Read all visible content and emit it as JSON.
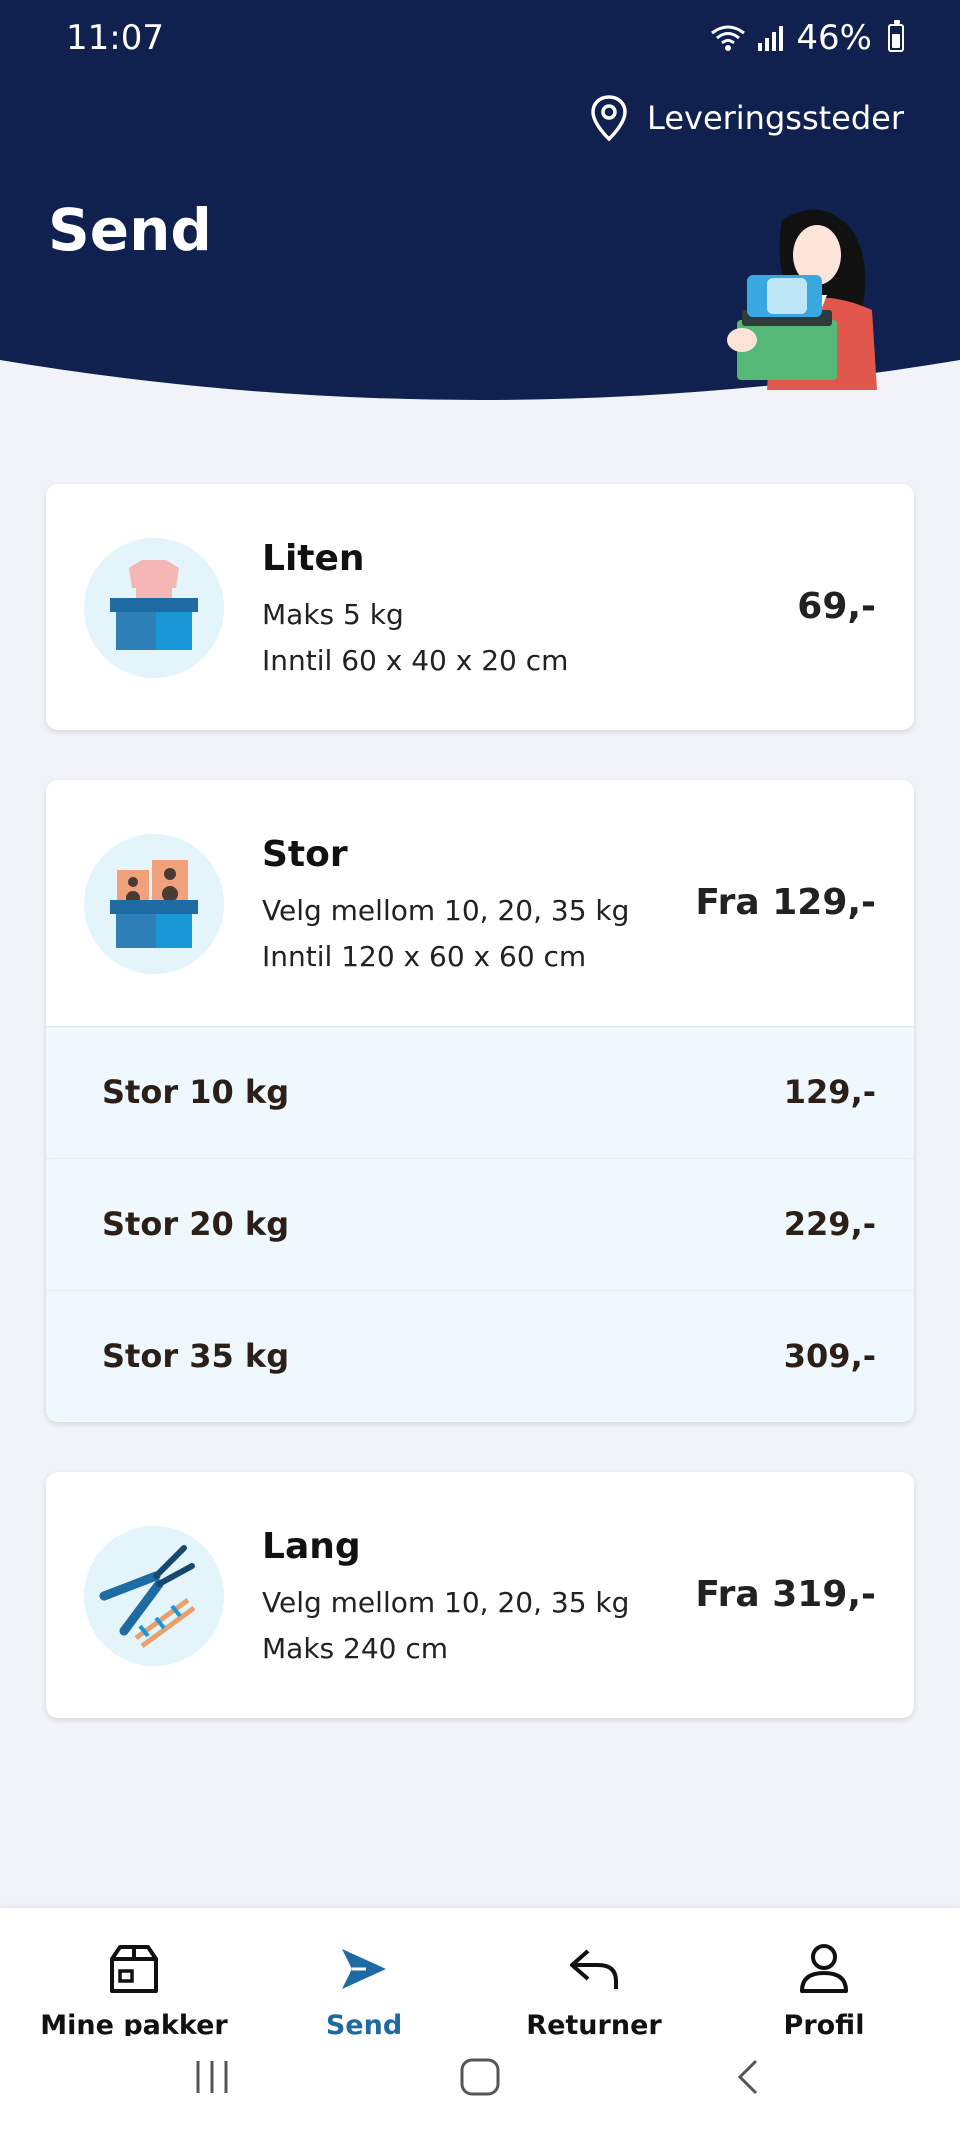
{
  "status_bar": {
    "time": "11:07",
    "battery": "46%"
  },
  "header": {
    "delivery_link": "Leveringssteder",
    "title": "Send"
  },
  "products": [
    {
      "title": "Liten",
      "line1": "Maks 5 kg",
      "line2": "Inntil 60 x 40 x 20 cm",
      "price": "69,-",
      "icon": "box-with-shirt-icon"
    },
    {
      "title": "Stor",
      "line1": "Velg mellom 10, 20, 35 kg",
      "line2": "Inntil 120 x 60 x 60 cm",
      "price": "Fra 129,-",
      "icon": "box-with-speakers-icon",
      "options": [
        {
          "label": "Stor 10 kg",
          "price": "129,-"
        },
        {
          "label": "Stor 20 kg",
          "price": "229,-"
        },
        {
          "label": "Stor 35 kg",
          "price": "309,-"
        }
      ]
    },
    {
      "title": "Lang",
      "line1": "Velg mellom 10, 20, 35 kg",
      "line2": "Maks 240 cm",
      "price": "Fra 319,-",
      "icon": "garden-shears-and-ski-icon"
    }
  ],
  "bottom_nav": [
    {
      "label": "Mine pakker",
      "icon": "package-icon"
    },
    {
      "label": "Send",
      "icon": "send-icon",
      "active": true
    },
    {
      "label": "Returner",
      "icon": "return-arrow-icon"
    },
    {
      "label": "Profil",
      "icon": "profile-icon"
    }
  ],
  "colors": {
    "header_bg": "#10214f",
    "accent": "#1e6aa3",
    "option_bg": "#eff9fd",
    "page_bg": "#f2f3f8"
  }
}
